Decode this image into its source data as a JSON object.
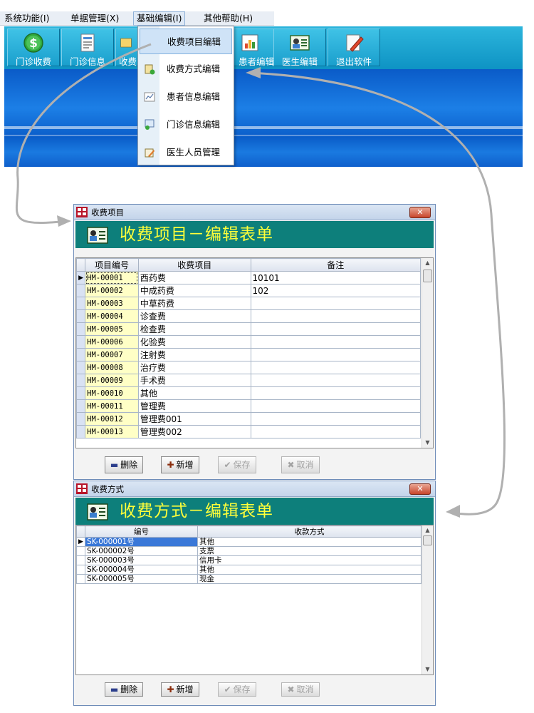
{
  "menubar": {
    "items": [
      {
        "label": "系统功能(I)"
      },
      {
        "label": "单据管理(X)"
      },
      {
        "label": "基础编辑(I)"
      },
      {
        "label": "其他帮助(H)"
      }
    ]
  },
  "toolbar": {
    "buttons": [
      {
        "label": "门诊收费",
        "icon": "dollar-icon"
      },
      {
        "label": "门诊信息",
        "icon": "document-icon"
      },
      {
        "label": "收费",
        "icon": "payment-icon"
      },
      {
        "label": "患者编辑",
        "icon": "chart-icon"
      },
      {
        "label": "医生编辑",
        "icon": "id-card-icon"
      },
      {
        "label": "退出软件",
        "icon": "exit-pencil-icon"
      }
    ]
  },
  "dropdown": {
    "items": [
      {
        "label": "收费项目编辑",
        "icon": "none"
      },
      {
        "label": "收费方式编辑",
        "icon": "add-doc-icon"
      },
      {
        "label": "患者信息编辑",
        "icon": "line-chart-icon"
      },
      {
        "label": "门诊信息编辑",
        "icon": "add-form-icon"
      },
      {
        "label": "医生人员管理",
        "icon": "user-edit-icon"
      }
    ]
  },
  "fee_items_dialog": {
    "title": "收费项目",
    "header": "收费项目－编辑表单",
    "columns": [
      "项目编号",
      "收费项目",
      "备注"
    ],
    "rows": [
      [
        "HM-00001",
        "西药费",
        "10101"
      ],
      [
        "HM-00002",
        "中成药费",
        "102"
      ],
      [
        "HM-00003",
        "中草药费",
        ""
      ],
      [
        "HM-00004",
        "诊查费",
        ""
      ],
      [
        "HM-00005",
        "检查费",
        ""
      ],
      [
        "HM-00006",
        "化验费",
        ""
      ],
      [
        "HM-00007",
        "注射费",
        ""
      ],
      [
        "HM-00008",
        "治疗费",
        ""
      ],
      [
        "HM-00009",
        "手术费",
        ""
      ],
      [
        "HM-00010",
        "其他",
        ""
      ],
      [
        "HM-00011",
        "管理费",
        ""
      ],
      [
        "HM-00012",
        "管理费001",
        ""
      ],
      [
        "HM-00013",
        "管理费002",
        ""
      ]
    ],
    "buttons": {
      "delete": "删除",
      "add": "新增",
      "save": "保存",
      "cancel": "取消"
    }
  },
  "payment_methods_dialog": {
    "title": "收费方式",
    "header": "收费方式－编辑表单",
    "columns": [
      "编号",
      "收款方式"
    ],
    "rows": [
      [
        "SK-000001号",
        "其他"
      ],
      [
        "SK-000002号",
        "支票"
      ],
      [
        "SK-000003号",
        "信用卡"
      ],
      [
        "SK-000004号",
        "其他"
      ],
      [
        "SK-000005号",
        "现金"
      ]
    ],
    "buttons": {
      "delete": "删除",
      "add": "新增",
      "save": "保存",
      "cancel": "取消"
    }
  },
  "colors": {
    "toolbar": "#1aa3d1",
    "banner": "#0a5bc8",
    "form_header": "#0d7f7b",
    "form_header_text": "#ffff3a",
    "code_cell": "#ffffc6"
  }
}
